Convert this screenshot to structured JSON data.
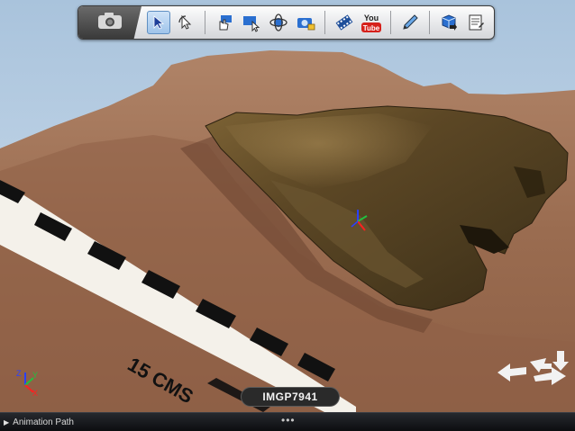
{
  "toolbar": {
    "tools": [
      {
        "name": "camera-icon"
      },
      {
        "name": "select-arrow-icon",
        "active": true
      },
      {
        "name": "orbit-select-icon"
      },
      {
        "name": "hand-pick-icon"
      },
      {
        "name": "pick-rect-icon"
      },
      {
        "name": "orbit-icon"
      },
      {
        "name": "snapshot-lock-icon"
      },
      {
        "name": "film-clip-icon"
      },
      {
        "name": "youtube-icon"
      },
      {
        "name": "measure-pen-icon"
      },
      {
        "name": "cube-export-icon"
      },
      {
        "name": "notes-icon"
      }
    ],
    "youtube_label_top": "You",
    "youtube_label_bottom": "Tube"
  },
  "scene": {
    "scale_label": "15 CMS",
    "image_name": "IMGP7941",
    "colors": {
      "sky": "#bcd3e8",
      "ground": "#9a6a4e",
      "artifact": "#5a4522",
      "scale_black": "#111111",
      "scale_white": "#f4f1ea"
    }
  },
  "bottom_bar": {
    "animation_path_label": "Animation Path",
    "toggle_glyph": "▶",
    "grip_glyph": "•••"
  }
}
